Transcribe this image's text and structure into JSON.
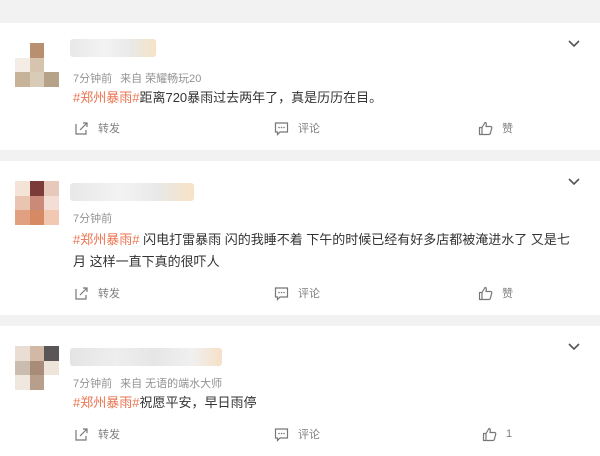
{
  "posts": [
    {
      "time": "7分钟前",
      "source": "来自 荣耀畅玩20",
      "tag": "#郑州暴雨#",
      "text": "距离720暴雨过去两年了，真是历历在目。",
      "actions": {
        "forward": "转发",
        "comment": "评论",
        "like": "赞"
      },
      "avatar_colors": [
        "#ffffff",
        "#b89070",
        "#ffffff",
        "#f4ede6",
        "#d6c4ae",
        "#ffffff",
        "#c7b39a",
        "#d8cbb8",
        "#b5a288"
      ]
    },
    {
      "time": "7分钟前",
      "source": "",
      "tag": "#郑州暴雨#",
      "text": " 闪电打雷暴雨 闪的我睡不着 下午的时候已经有好多店都被淹进水了 又是七月 这样一直下真的很吓人",
      "actions": {
        "forward": "转发",
        "comment": "评论",
        "like": "赞"
      },
      "avatar_colors": [
        "#f4e4d8",
        "#7b3b38",
        "#e7c9bc",
        "#e8c4b1",
        "#c98a79",
        "#f3ddd4",
        "#e0a081",
        "#d68a63",
        "#f2c8b2"
      ]
    },
    {
      "time": "7分钟前",
      "source": "来自 无语的端水大师",
      "tag": "#郑州暴雨#",
      "text": "祝愿平安，早日雨停",
      "actions": {
        "forward": "转发",
        "comment": "评论",
        "like": "1"
      },
      "avatar_colors": [
        "#e9ddd4",
        "#d2b9a5",
        "#5a5556",
        "#cbbcb0",
        "#a98b7a",
        "#efe4da",
        "#f0e8df",
        "#b79f8c",
        "#ffffff"
      ]
    }
  ]
}
